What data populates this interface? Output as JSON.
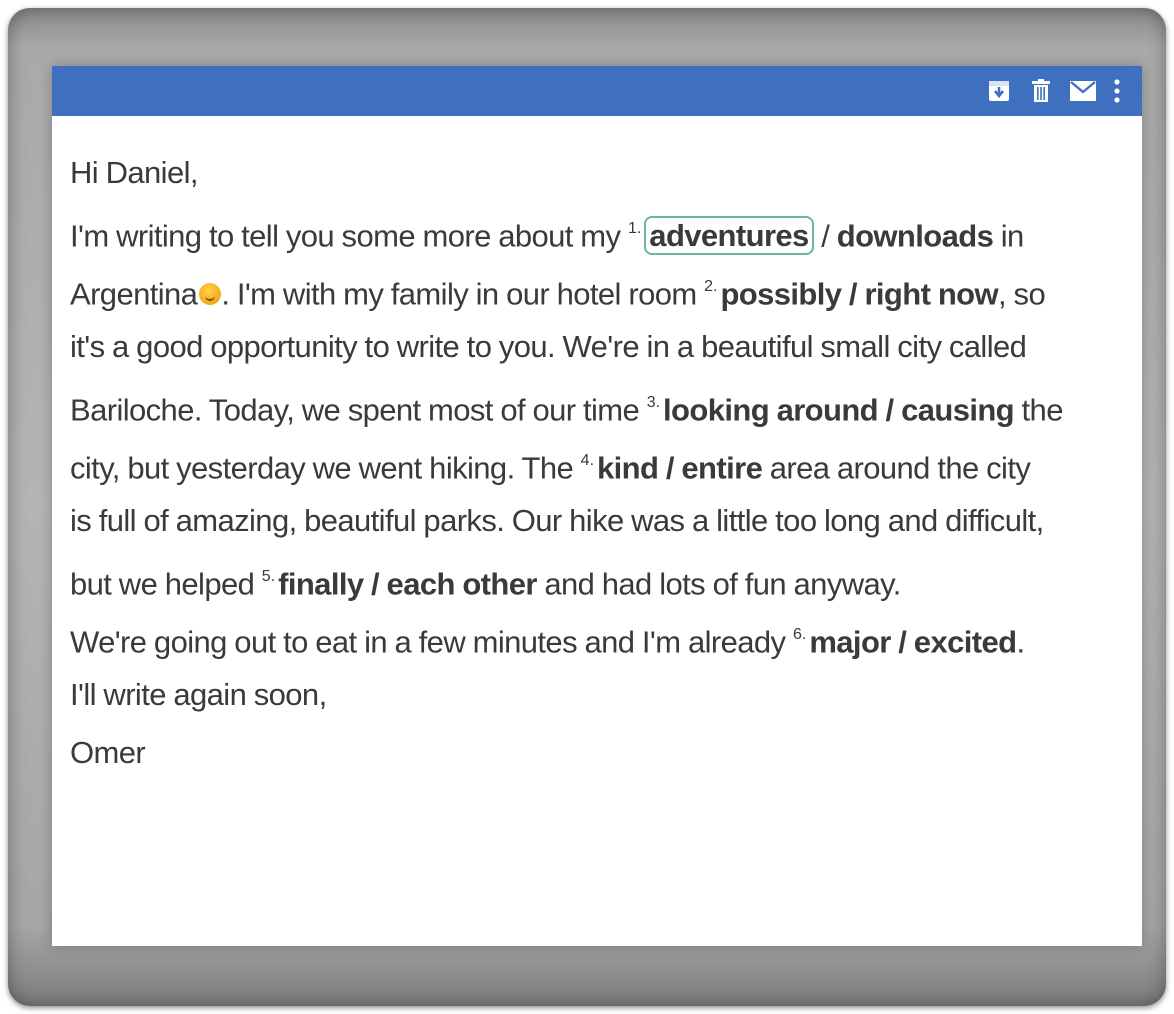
{
  "toolbar": {
    "icons": [
      "download-icon",
      "trash-icon",
      "mail-icon",
      "more-vert-icon"
    ],
    "color": "#3f6fbf"
  },
  "email": {
    "greeting": "Hi Daniel,",
    "lines": {
      "l1_a": "I'm writing to tell you some more about my ",
      "l1_b": " in",
      "l2_a": "Argentina",
      "l2_b": ". I'm with my family in our hotel room ",
      "l2_c": ", so",
      "l3": "it's a good opportunity to write to you. We're in a beautiful small city called",
      "l4_a": "Bariloche. Today, we spent most of our time ",
      "l4_b": " the",
      "l5_a": "city, but yesterday we went hiking. The ",
      "l5_b": " area around the city",
      "l6": "is full of amazing, beautiful parks. Our hike was a little too long and difficult,",
      "l7_a": "but we helped ",
      "l7_b": " and had lots of fun anyway.",
      "l8_a": "We're going out to eat in a few minutes and I'm already ",
      "l8_b": "."
    },
    "closing": "I'll write again soon,",
    "signature": "Omer"
  },
  "gaps": [
    {
      "num": "1.",
      "option_a": "adventures",
      "option_b": "downloads",
      "separator": " / ",
      "selected": "adventures"
    },
    {
      "num": "2.",
      "option_a": "possibly",
      "option_b": "right now",
      "separator": " / "
    },
    {
      "num": "3.",
      "option_a": "looking around",
      "option_b": "causing",
      "separator": " / "
    },
    {
      "num": "4.",
      "option_a": "kind",
      "option_b": "entire",
      "separator": " / "
    },
    {
      "num": "5.",
      "option_a": "finally",
      "option_b": "each other",
      "separator": " / "
    },
    {
      "num": "6.",
      "option_a": "major",
      "option_b": "excited",
      "separator": " / "
    }
  ]
}
